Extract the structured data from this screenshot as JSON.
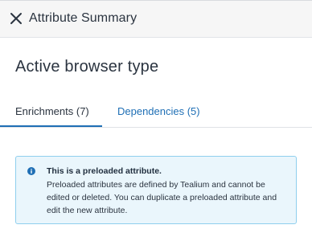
{
  "header": {
    "close_icon": "close-icon",
    "title": "Attribute Summary"
  },
  "page": {
    "title": "Active browser type"
  },
  "tabs": [
    {
      "label": "Enrichments (7)",
      "active": true
    },
    {
      "label": "Dependencies (5)",
      "active": false
    }
  ],
  "info": {
    "icon": "info-icon",
    "heading": "This is a preloaded attribute.",
    "text": "Preloaded attributes are defined by Tealium and cannot be edited or deleted. You can duplicate a preloaded attribute and edit the new attribute."
  },
  "colors": {
    "accent": "#1f6fb5",
    "info_background": "#eaf6fc",
    "info_border": "#8fcfee",
    "header_background": "#f6f6f6"
  }
}
